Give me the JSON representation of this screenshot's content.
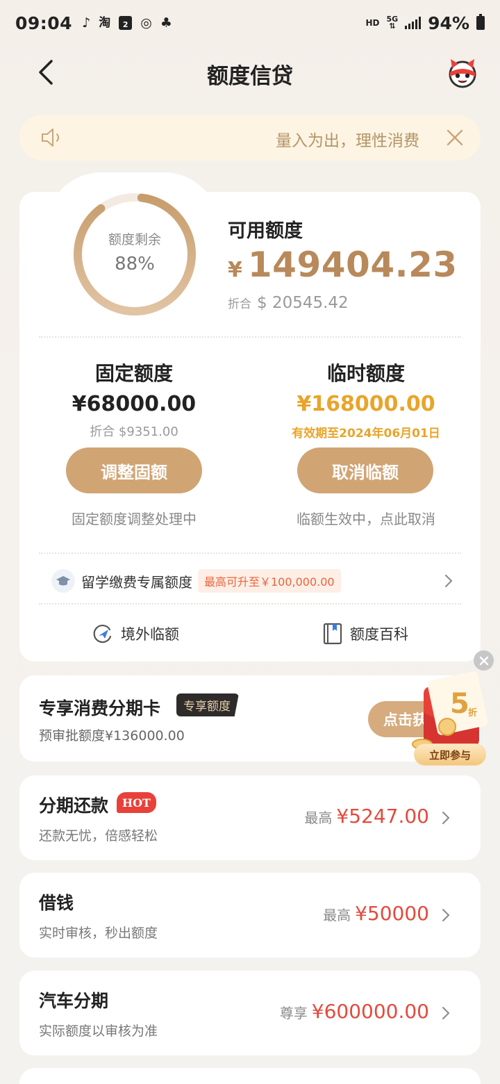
{
  "status_bar": {
    "time": "09:04",
    "calendar_day": "2",
    "hd": "HD",
    "network": "5G",
    "battery_pct": "94%"
  },
  "header": {
    "title": "额度信贷"
  },
  "notice": {
    "text": "量入为出，理性消费"
  },
  "credit": {
    "ring_label": "额度剩余",
    "ring_percent_text": "88%",
    "ring_fraction": 0.88,
    "available_title": "可用额度",
    "available_currency": "¥",
    "available_amount": "149404.23",
    "converted_label": "折合",
    "converted_amount": "$ 20545.42",
    "fixed": {
      "title": "固定额度",
      "amount": "¥68000.00",
      "converted": "折合 $9351.00",
      "button": "调整固额",
      "status": "固定额度调整处理中"
    },
    "temp": {
      "title": "临时额度",
      "amount": "¥168000.00",
      "valid": "有效期至2024年06月01日",
      "button": "取消临额",
      "status": "临额生效中，点此取消"
    },
    "study": {
      "label": "留学缴费专属额度",
      "tag": "最高可升至￥100,000.00"
    },
    "links": [
      {
        "label": "境外临额",
        "icon": "plane-circle-icon"
      },
      {
        "label": "额度百科",
        "icon": "book-icon"
      }
    ]
  },
  "exclusive": {
    "title": "专享消费分期卡",
    "tag": "专享额度",
    "subtitle": "预审批额度¥136000.00",
    "button": "点击获"
  },
  "promo": {
    "discount": "5",
    "discount_unit": "折",
    "join": "立即参与"
  },
  "loans": [
    {
      "title": "分期还款",
      "badge": "HOT",
      "subtitle": "还款无忧，倍感轻松",
      "prefix": "最高",
      "amount": "¥5247.00"
    },
    {
      "title": "借钱",
      "badge": "",
      "subtitle": "实时审核，秒出额度",
      "prefix": "最高",
      "amount": "¥50000"
    },
    {
      "title": "汽车分期",
      "badge": "",
      "subtitle": "实际额度以审核为准",
      "prefix": "尊享",
      "amount": "¥600000.00"
    }
  ],
  "colors": {
    "accent": "#d1a474",
    "amount_gold": "#b8895a",
    "temp_orange": "#e9a42a",
    "loan_red": "#e34a3c"
  }
}
